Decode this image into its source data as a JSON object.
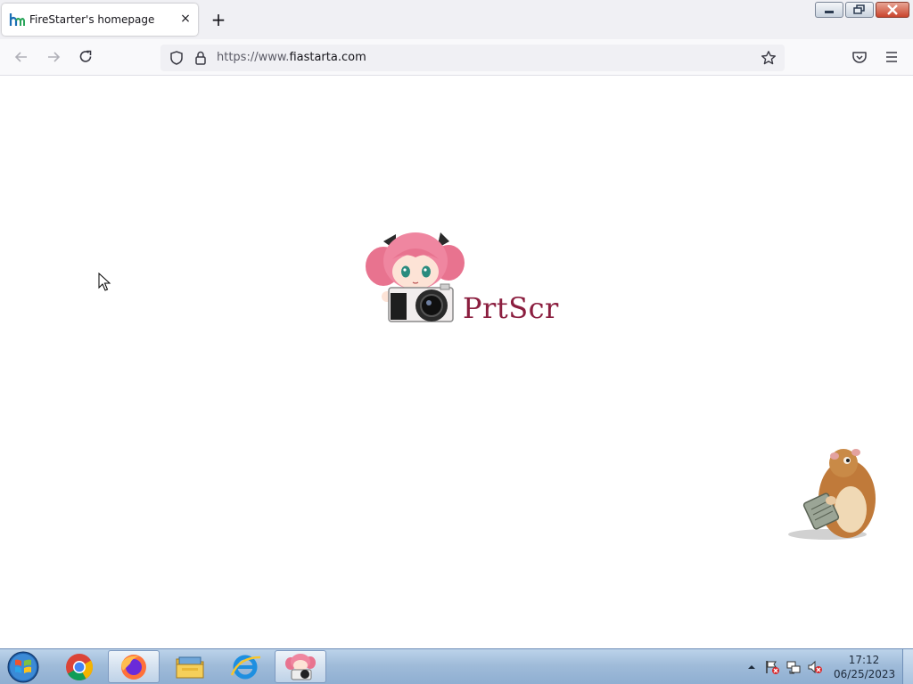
{
  "browser": {
    "tab": {
      "title": "FireStarter's homepage",
      "close_glyph": "×",
      "favicon": "hm-logo-icon"
    },
    "new_tab_glyph": "+",
    "url": {
      "scheme": "https://www.",
      "host": "fiastarta.com"
    },
    "icons": [
      "back-arrow-icon",
      "forward-arrow-icon",
      "reload-icon",
      "shield-icon",
      "lock-icon",
      "star-icon",
      "pocket-icon",
      "hamburger-menu-icon"
    ]
  },
  "window_controls": [
    "minimize",
    "restore",
    "close"
  ],
  "page": {
    "logo_text": "PrtScr"
  },
  "taskbar": {
    "apps": [
      "start-orb",
      "chrome",
      "firefox",
      "file-explorer",
      "internet-explorer",
      "prtscr"
    ],
    "active_app": "firefox",
    "clock": {
      "time": "17:12",
      "date": "06/25/2023"
    }
  },
  "colors": {
    "logo_text": "#8b1e3f",
    "tab_strip": "#f0f0f4",
    "taskbar": "#9fbbd9"
  }
}
